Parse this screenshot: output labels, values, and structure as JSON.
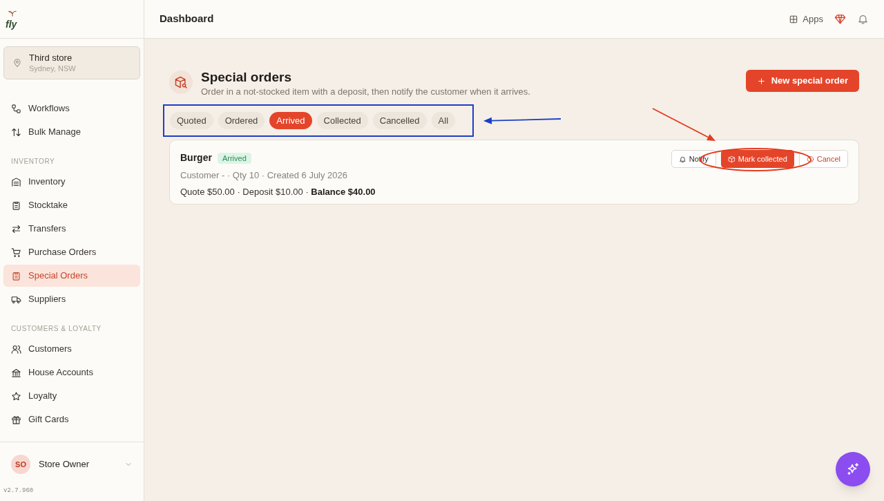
{
  "brand": {
    "logo_text": "fly"
  },
  "store": {
    "name": "Third store",
    "location": "Sydney, NSW"
  },
  "sidebar": {
    "sections": [
      {
        "items": [
          {
            "label": "Workflows",
            "selected": false
          },
          {
            "label": "Bulk Manage",
            "selected": false
          }
        ]
      },
      {
        "heading": "INVENTORY",
        "items": [
          {
            "label": "Inventory",
            "selected": false
          },
          {
            "label": "Stocktake",
            "selected": false
          },
          {
            "label": "Transfers",
            "selected": false
          },
          {
            "label": "Purchase Orders",
            "selected": false
          },
          {
            "label": "Special Orders",
            "selected": true
          },
          {
            "label": "Suppliers",
            "selected": false
          }
        ]
      },
      {
        "heading": "CUSTOMERS & LOYALTY",
        "items": [
          {
            "label": "Customers",
            "selected": false
          },
          {
            "label": "House Accounts",
            "selected": false
          },
          {
            "label": "Loyalty",
            "selected": false
          },
          {
            "label": "Gift Cards",
            "selected": false
          }
        ]
      }
    ]
  },
  "user": {
    "initials": "SO",
    "name": "Store Owner"
  },
  "version": "v2.7.960",
  "header": {
    "title": "Dashboard",
    "apps_label": "Apps"
  },
  "page": {
    "title": "Special orders",
    "subtitle": "Order in a not-stocked item with a deposit, then notify the customer when it arrives.",
    "new_button": "New special order"
  },
  "tabs": [
    {
      "label": "Quoted",
      "selected": false
    },
    {
      "label": "Ordered",
      "selected": false
    },
    {
      "label": "Arrived",
      "selected": true
    },
    {
      "label": "Collected",
      "selected": false
    },
    {
      "label": "Cancelled",
      "selected": false
    },
    {
      "label": "All",
      "selected": false
    }
  ],
  "orders": [
    {
      "name": "Burger",
      "status": "Arrived",
      "meta": "Customer - · Qty 10 · Created 6 July 2026",
      "amounts": "Quote $50.00 · Deposit $10.00 · **Balance $40.00**",
      "actions": [
        {
          "kind": "notify",
          "label": "Notify"
        },
        {
          "kind": "collect",
          "label": "Mark collected"
        },
        {
          "kind": "cancel",
          "label": "Cancel"
        }
      ]
    }
  ],
  "annotations": [
    {
      "kind": "box",
      "color": "#1a3ec8"
    },
    {
      "kind": "arrow",
      "color": "#1a3ec8"
    },
    {
      "kind": "arrow",
      "color": "#e53b1e"
    },
    {
      "kind": "ellipse",
      "color": "#e53b1e"
    }
  ]
}
